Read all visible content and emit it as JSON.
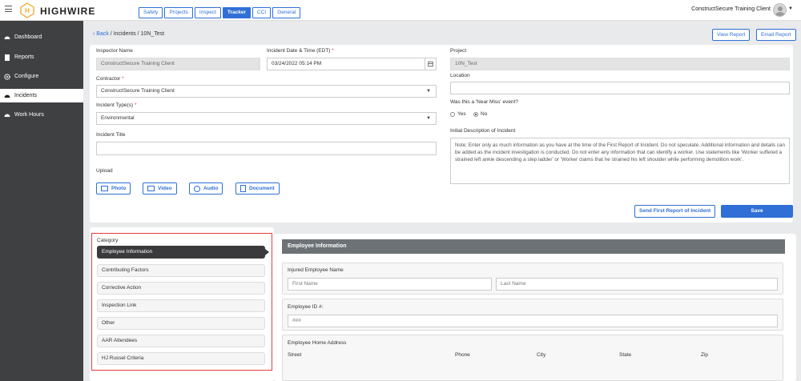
{
  "app": {
    "name": "HIGHWIRE",
    "user": "ConstructSecure Training Client"
  },
  "tabs": [
    "Safety",
    "Projects",
    "Inspect",
    "Tracker",
    "CCI",
    "General"
  ],
  "active_tab": "Tracker",
  "sidebar": {
    "items": [
      {
        "label": "Dashboard",
        "icon": "dashboard-icon"
      },
      {
        "label": "Reports",
        "icon": "reports-icon"
      },
      {
        "label": "Configure",
        "icon": "gear-icon"
      },
      {
        "label": "Incidents",
        "icon": "incidents-icon",
        "active": true
      },
      {
        "label": "Work Hours",
        "icon": "clock-icon"
      }
    ]
  },
  "breadcrumb": {
    "back": "Back",
    "path": "/ Incidents / 10N_Test"
  },
  "actions": {
    "view_report": "View Report",
    "email_report": "Email Report"
  },
  "form": {
    "inspector_name": {
      "label": "Inspector Name",
      "value": "ConstructSecure  Training Client"
    },
    "incident_datetime": {
      "label": "Incident Date & Time (EDT)",
      "value": "03/24/2022 05:14 PM"
    },
    "project": {
      "label": "Project",
      "value": "10N_Test"
    },
    "contractor": {
      "label": "Contractor",
      "value": "ConstructSecure Training Client"
    },
    "location": {
      "label": "Location",
      "value": ""
    },
    "incident_types": {
      "label": "Incident Type(s)",
      "value": "Environmental"
    },
    "near_miss": {
      "label": "Was this a 'Near Miss' event?",
      "yes": "Yes",
      "no": "No",
      "selected": "No"
    },
    "incident_title": {
      "label": "Incident Title",
      "value": ""
    },
    "initial_description": {
      "label": "Initial Description of Incident",
      "placeholder": "Note: Enter only as much information as you have at the time of the First Report of Incident. Do not speculate. Additional information and details can be added as the incident investigation is conducted.  Do not enter any information that can identify a worker.  Use statements like 'Worker suffered a strained left ankle descending a step ladder' or 'Worker claims that he strained his left shoulder while performing demolition work'."
    },
    "upload": {
      "label": "Upload",
      "photo": "Photo",
      "video": "Video",
      "audio": "Audio",
      "document": "Document"
    },
    "send_first_report": "Send First Report of Incident",
    "save": "Save"
  },
  "category": {
    "label": "Category",
    "items": [
      "Employee Information",
      "Contributing Factors",
      "Corrective Action",
      "Inspection Link",
      "Other",
      "AAR Attendees",
      "HJ Russel Criteria"
    ],
    "active": "Employee Information"
  },
  "employee": {
    "header": "Employee Information",
    "injured_name_label": "Injured Employee Name",
    "first_name_placeholder": "First Name",
    "last_name_placeholder": "Last Name",
    "id_label": "Employee ID #:",
    "id_placeholder": "###",
    "address_label": "Employee Home Address",
    "address_columns": [
      "Street",
      "Phone",
      "City",
      "State",
      "Zip"
    ]
  }
}
